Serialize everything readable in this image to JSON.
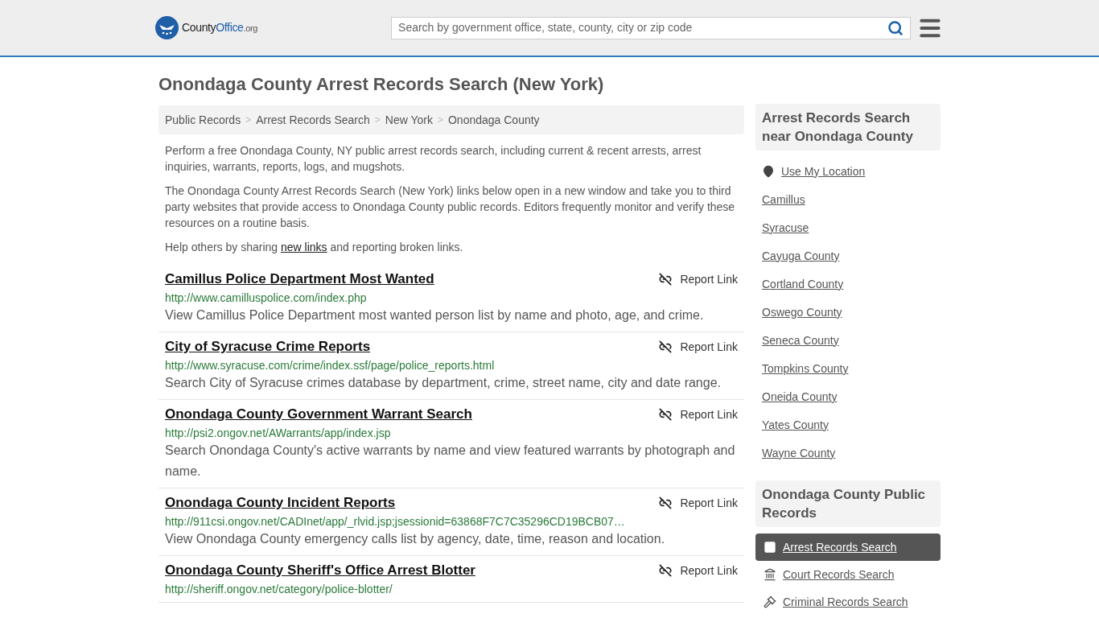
{
  "header": {
    "logo": {
      "part_1": "County",
      "part_2": "Office",
      "part_3": ".org"
    },
    "search": {
      "placeholder": "Search by government office, state, county, city or zip code"
    }
  },
  "page_title": "Onondaga County Arrest Records Search (New York)",
  "breadcrumbs": {
    "separator": ">",
    "items": [
      "Public Records",
      "Arrest Records Search",
      "New York",
      "Onondaga County"
    ]
  },
  "intro": [
    "Perform a free Onondaga County, NY public arrest records search, including current & recent arrests, arrest inquiries, warrants, reports, logs, and mugshots.",
    "The Onondaga County Arrest Records Search (New York) links below open in a new window and take you to third party websites that provide access to Onondaga County public records. Editors frequently monitor and verify these resources on a routine basis."
  ],
  "help": {
    "before": "Help others by sharing",
    "link": "new links",
    "after": "and reporting broken links."
  },
  "results": [
    {
      "title": "Camillus Police Department Most Wanted",
      "url": "http://www.camilluspolice.com/index.php",
      "description": "View Camillus Police Department most wanted person list by name and photo, age, and crime.",
      "report": "Report Link"
    },
    {
      "title": "City of Syracuse Crime Reports",
      "url": "http://www.syracuse.com/crime/index.ssf/page/police_reports.html",
      "description": "Search City of Syracuse crimes database by department, crime, street name, city and date range.",
      "report": "Report Link"
    },
    {
      "title": "Onondaga County Government Warrant Search",
      "url": "http://psi2.ongov.net/AWarrants/app/index.jsp",
      "description": "Search Onondaga County's active warrants by name and view featured warrants by photograph and name.",
      "report": "Report Link"
    },
    {
      "title": "Onondaga County Incident Reports",
      "url": "http://911csi.ongov.net/CADInet/app/_rlvid.jsp;jsessionid=63868F7C7C35296CD19BCB07…",
      "description": "View Onondaga County emergency calls list by agency, date, time, reason and location.",
      "report": "Report Link"
    },
    {
      "title": "Onondaga County Sheriff's Office Arrest Blotter",
      "url": "http://sheriff.ongov.net/category/police-blotter/",
      "report": "Report Link"
    }
  ],
  "sidebar": {
    "nearby": {
      "heading": "Arrest Records Search near Onondaga County",
      "location": "Use My Location",
      "links": [
        "Camillus",
        "Syracuse",
        "Cayuga County",
        "Cortland County",
        "Oswego County",
        "Seneca County",
        "Tompkins County",
        "Oneida County",
        "Yates County",
        "Wayne County"
      ]
    },
    "public_records": {
      "heading": "Onondaga County Public Records",
      "items": [
        {
          "label": "Arrest Records Search",
          "kind": "arrest",
          "selected": true
        },
        {
          "label": "Court Records Search",
          "kind": "court",
          "selected": false
        },
        {
          "label": "Criminal Records Search",
          "kind": "criminal",
          "selected": false
        }
      ]
    }
  }
}
